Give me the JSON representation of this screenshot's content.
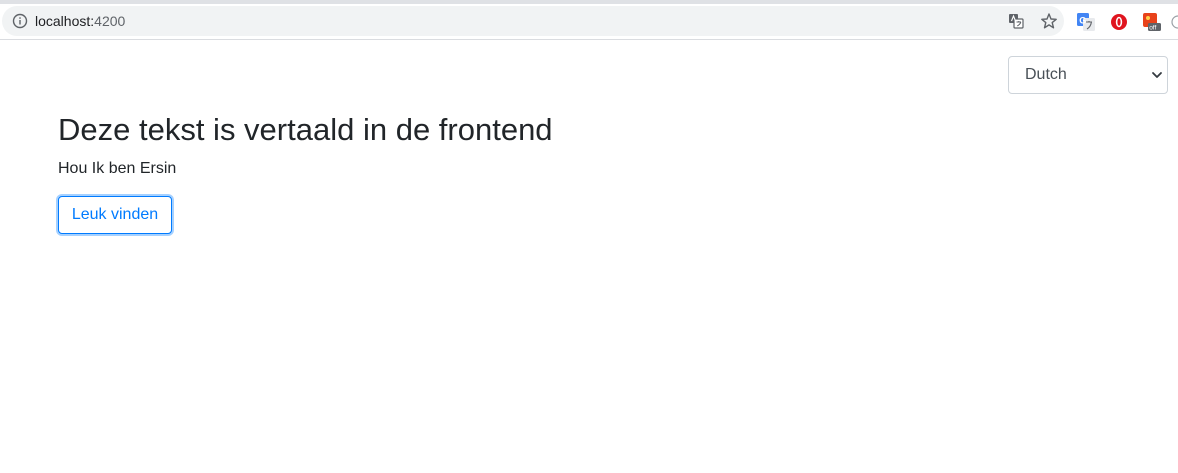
{
  "browser": {
    "url_host": "localhost:",
    "url_port": "4200",
    "icons": {
      "info": "info-icon",
      "translate": "translate-icon",
      "bookmark": "star-icon",
      "extensions": [
        "google-translate-extension-icon",
        "opera-extension-icon",
        "red-extension-icon"
      ]
    },
    "extension_badge": "off"
  },
  "language_select": {
    "selected": "Dutch"
  },
  "main": {
    "heading": "Deze tekst is vertaald in de frontend",
    "subtext": "Hou Ik ben Ersin",
    "like_button": "Leuk vinden"
  },
  "colors": {
    "accent": "#007bff",
    "text": "#212529"
  }
}
